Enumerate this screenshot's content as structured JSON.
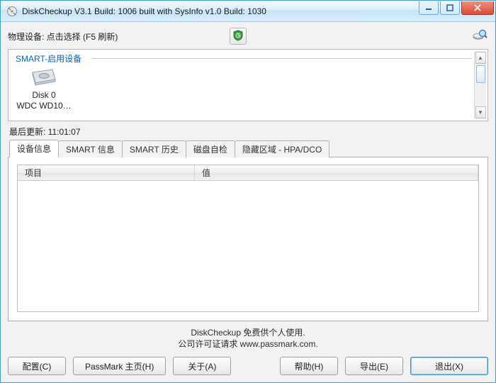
{
  "window": {
    "title": "DiskCheckup V3.1 Build: 1006 built with SysInfo v1.0 Build: 1030"
  },
  "top": {
    "device_label": "物理设备: 点击选择 (F5 刷新)"
  },
  "device_list": {
    "group_header": "SMART-启用设备",
    "items": [
      {
        "name": "Disk 0",
        "model": "WDC WD10…"
      }
    ]
  },
  "last_update": {
    "label": "最后更新: 11:01:07"
  },
  "tabs": [
    {
      "label": "设备信息",
      "active": true
    },
    {
      "label": "SMART 信息",
      "active": false
    },
    {
      "label": "SMART 历史",
      "active": false
    },
    {
      "label": "磁盘自检",
      "active": false
    },
    {
      "label": "隐藏区域 - HPA/DCO",
      "active": false
    }
  ],
  "list": {
    "columns": {
      "project": "项目",
      "value": "值"
    }
  },
  "footer": {
    "line1": "DiskCheckup 免费供个人使用.",
    "line2": "公司许可证请求 www.passmark.com."
  },
  "buttons": {
    "config": "配置(C)",
    "homepage": "PassMark 主页(H)",
    "about": "关于(A)",
    "help": "帮助(H)",
    "export": "导出(E)",
    "exit": "退出(X)"
  }
}
